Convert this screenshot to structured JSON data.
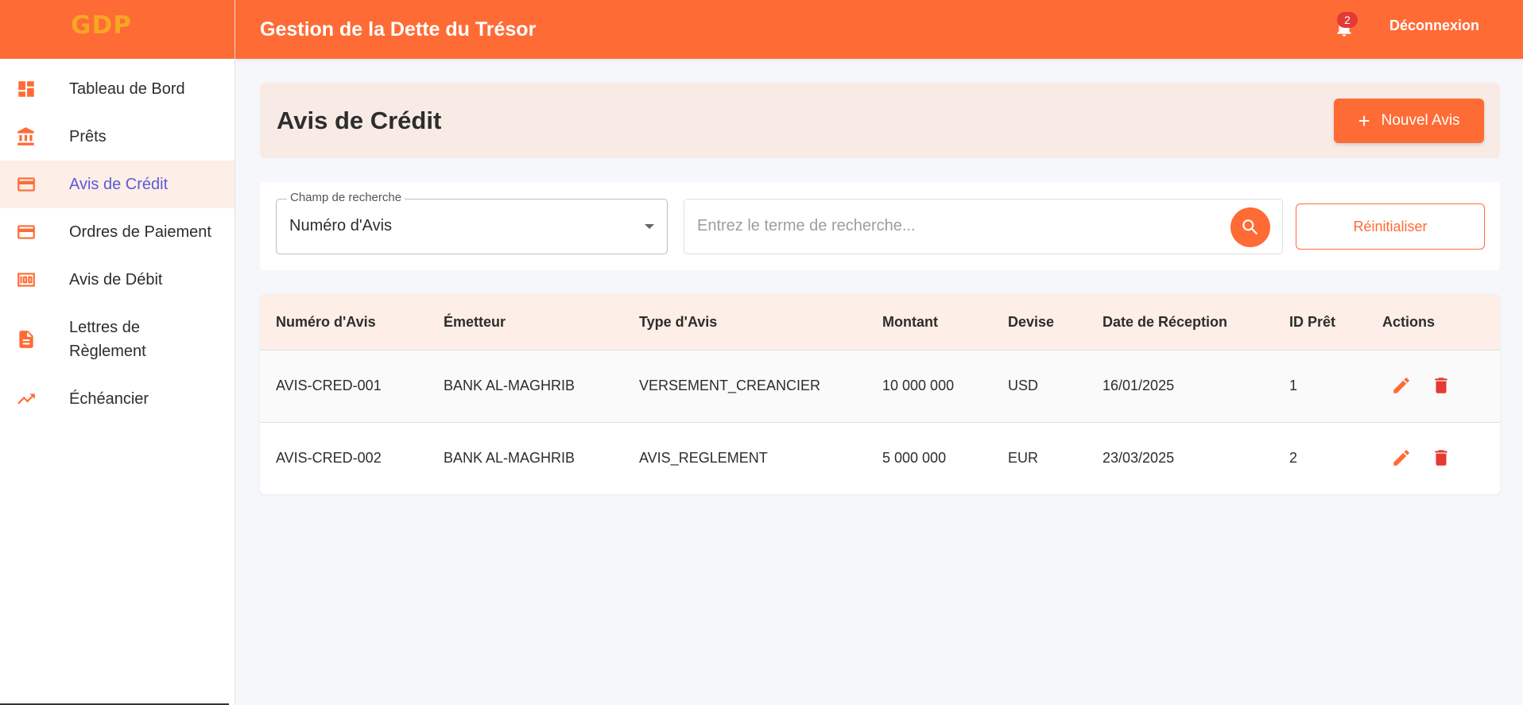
{
  "app": {
    "logo": "GDP",
    "title": "Gestion de la Dette du Trésor",
    "notification_count": "2",
    "logout_label": "Déconnexion"
  },
  "colors": {
    "primary": "#ff6b35",
    "active_label": "#5b5bd6",
    "danger": "#e53935"
  },
  "sidebar": {
    "items": [
      {
        "label": "Tableau de Bord",
        "icon": "dashboard-icon",
        "active": false
      },
      {
        "label": "Prêts",
        "icon": "bank-icon",
        "active": false
      },
      {
        "label": "Avis de Crédit",
        "icon": "credit-card-icon",
        "active": true
      },
      {
        "label": "Ordres de Paiement",
        "icon": "credit-card-icon",
        "active": false
      },
      {
        "label": "Avis de Débit",
        "icon": "money-icon",
        "active": false
      },
      {
        "label": "Lettres de Règlement",
        "icon": "document-icon",
        "active": false
      },
      {
        "label": "Échéancier",
        "icon": "trending-up-icon",
        "active": false
      }
    ]
  },
  "page": {
    "title": "Avis de Crédit",
    "new_button_label": "Nouvel Avis"
  },
  "search": {
    "field_label": "Champ de recherche",
    "field_value": "Numéro d'Avis",
    "placeholder": "Entrez le terme de recherche...",
    "reset_label": "Réinitialiser"
  },
  "table": {
    "columns": [
      "Numéro d'Avis",
      "Émetteur",
      "Type d'Avis",
      "Montant",
      "Devise",
      "Date de Réception",
      "ID Prêt",
      "Actions"
    ],
    "rows": [
      {
        "numero": "AVIS-CRED-001",
        "emetteur": "BANK AL-MAGHRIB",
        "type": "VERSEMENT_CREANCIER",
        "montant": "10 000 000",
        "devise": "USD",
        "date": "16/01/2025",
        "id_pret": "1"
      },
      {
        "numero": "AVIS-CRED-002",
        "emetteur": "BANK AL-MAGHRIB",
        "type": "AVIS_REGLEMENT",
        "montant": "5 000 000",
        "devise": "EUR",
        "date": "23/03/2025",
        "id_pret": "2"
      }
    ]
  }
}
